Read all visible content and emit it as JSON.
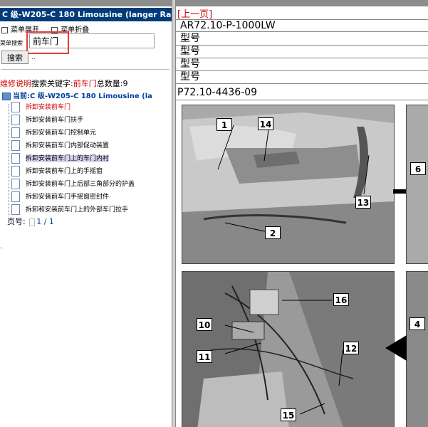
{
  "left_panel": {
    "title": "C 级-W205-C 180 Limousine (langer Rads",
    "menu_expand": "菜单展开",
    "menu_collapse": "菜单折叠",
    "search_label": "菜单搜索",
    "search_value": "前车门",
    "search_button": "搜索",
    "dots": "..",
    "summary": {
      "prefix": "维修说明",
      "mid": "搜索关键字:",
      "keyword": "前车门",
      "count_label": "总数量:",
      "count": "9"
    },
    "current": "当前:C 级-W205-C 180 Limousine (la",
    "tree_items": [
      "拆卸安装前车门",
      "拆卸安装前车门扶手",
      "拆卸安装前车门控制单元",
      "拆卸安装前车门内部促动装置",
      "拆卸安装前车门上的车门内衬",
      "拆卸安装前车门上的手摇窗",
      "拆卸安装前车门上后部三角部分的护盖",
      "拆卸安装前车门手摇窗密封件",
      "拆卸和安装前车门上的外部车门拉手"
    ],
    "page_label": "页号:",
    "page_value": "1 / 1",
    "link_dot": "."
  },
  "right_panel": {
    "prev_page": "[上一页]",
    "doc_code": "AR72.10-P-1000LW",
    "type_rows": [
      "型号",
      "型号",
      "型号",
      "型号"
    ],
    "image_code": "P72.10-4436-09",
    "callouts_top": [
      "1",
      "14",
      "13",
      "2",
      "6"
    ],
    "callouts_bottom": [
      "16",
      "10",
      "11",
      "12",
      "15",
      "4"
    ]
  },
  "colors": {
    "title_bar": "#003b7a",
    "red": "#d10000",
    "highlight": "#d8d3f0",
    "link_blue": "#0040a0"
  }
}
